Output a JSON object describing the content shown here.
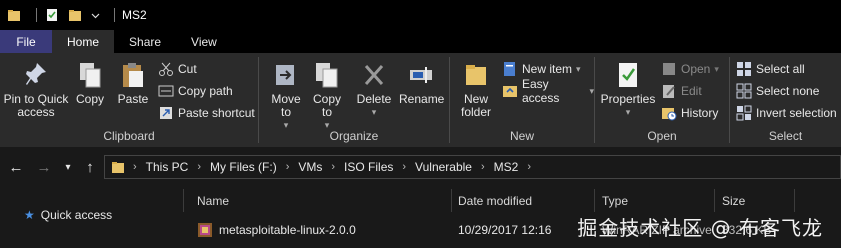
{
  "titlebar": {
    "title": "MS2"
  },
  "tabs": [
    {
      "label": "File"
    },
    {
      "label": "Home"
    },
    {
      "label": "Share"
    },
    {
      "label": "View"
    }
  ],
  "ribbon": {
    "clipboard": {
      "label": "Clipboard",
      "pin": "Pin to Quick access",
      "copy": "Copy",
      "paste": "Paste",
      "cut": "Cut",
      "copy_path": "Copy path",
      "paste_shortcut": "Paste shortcut"
    },
    "organize": {
      "label": "Organize",
      "move_to": "Move to",
      "copy_to": "Copy to",
      "delete": "Delete",
      "rename": "Rename"
    },
    "new": {
      "label": "New",
      "new_folder": "New folder",
      "new_item": "New item",
      "easy_access": "Easy access"
    },
    "open": {
      "label": "Open",
      "properties": "Properties",
      "open": "Open",
      "edit": "Edit",
      "history": "History"
    },
    "select": {
      "label": "Select",
      "select_all": "Select all",
      "select_none": "Select none",
      "invert_selection": "Invert selection"
    }
  },
  "breadcrumb": [
    "This PC",
    "My Files (F:)",
    "VMs",
    "ISO Files",
    "Vulnerable",
    "MS2"
  ],
  "columns": {
    "name": "Name",
    "date": "Date modified",
    "type": "Type",
    "size": "Size"
  },
  "nav_pane": {
    "quick_access": "Quick access"
  },
  "files": [
    {
      "name": "metasploitable-linux-2.0.0",
      "date": "10/29/2017 12:16",
      "type": "WinRAR ZIP archive",
      "size": "832,6 KB"
    }
  ],
  "watermark": "掘金技术社区 @ 布客飞龙",
  "colors": {
    "accent": "#3a3a7a",
    "folder": "#e8c46a",
    "background": "#191919",
    "ribbon": "#2b2b2b"
  }
}
